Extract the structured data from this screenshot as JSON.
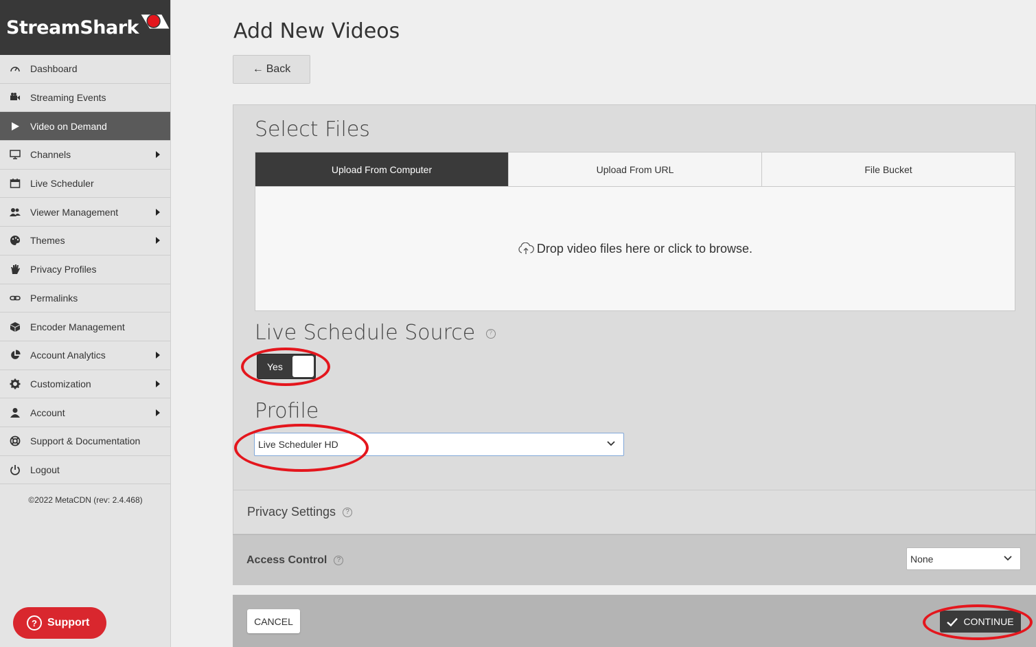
{
  "brand": {
    "name": "StreamShark",
    "accent": "#e4161d"
  },
  "sidebar": {
    "items": [
      {
        "label": "Dashboard",
        "icon": "gauge-icon",
        "caret": false,
        "active": false
      },
      {
        "label": "Streaming Events",
        "icon": "video-camera-icon",
        "caret": false,
        "active": false
      },
      {
        "label": "Video on Demand",
        "icon": "play-icon",
        "caret": false,
        "active": true
      },
      {
        "label": "Channels",
        "icon": "monitor-icon",
        "caret": true,
        "active": false
      },
      {
        "label": "Live Scheduler",
        "icon": "calendar-icon",
        "caret": false,
        "active": false
      },
      {
        "label": "Viewer Management",
        "icon": "users-icon",
        "caret": true,
        "active": false
      },
      {
        "label": "Themes",
        "icon": "palette-icon",
        "caret": true,
        "active": false
      },
      {
        "label": "Privacy Profiles",
        "icon": "hand-icon",
        "caret": false,
        "active": false
      },
      {
        "label": "Permalinks",
        "icon": "link-icon",
        "caret": false,
        "active": false
      },
      {
        "label": "Encoder Management",
        "icon": "cube-icon",
        "caret": false,
        "active": false
      },
      {
        "label": "Account Analytics",
        "icon": "pie-chart-icon",
        "caret": true,
        "active": false
      },
      {
        "label": "Customization",
        "icon": "gear-icon",
        "caret": true,
        "active": false
      },
      {
        "label": "Account",
        "icon": "user-icon",
        "caret": true,
        "active": false
      },
      {
        "label": "Support & Documentation",
        "icon": "lifebuoy-icon",
        "caret": false,
        "active": false
      },
      {
        "label": "Logout",
        "icon": "power-icon",
        "caret": false,
        "active": false
      }
    ],
    "copyright": "©2022 MetaCDN (rev: 2.4.468)",
    "support_label": "Support"
  },
  "main": {
    "title": "Add New Videos",
    "back_label": "Back",
    "select_files": {
      "title": "Select Files",
      "tabs": [
        "Upload From Computer",
        "Upload From URL",
        "File Bucket"
      ],
      "active_tab": 0,
      "dropzone_text": "Drop video files here or click to browse."
    },
    "live_schedule": {
      "title": "Live Schedule Source",
      "toggle_label": "Yes",
      "toggle_on": true
    },
    "profile": {
      "title": "Profile",
      "value": "Live Scheduler HD"
    },
    "privacy": {
      "title": "Privacy Settings"
    },
    "access_control": {
      "label": "Access Control",
      "value": "None"
    },
    "footer": {
      "cancel_label": "CANCEL",
      "continue_label": "CONTINUE"
    }
  }
}
